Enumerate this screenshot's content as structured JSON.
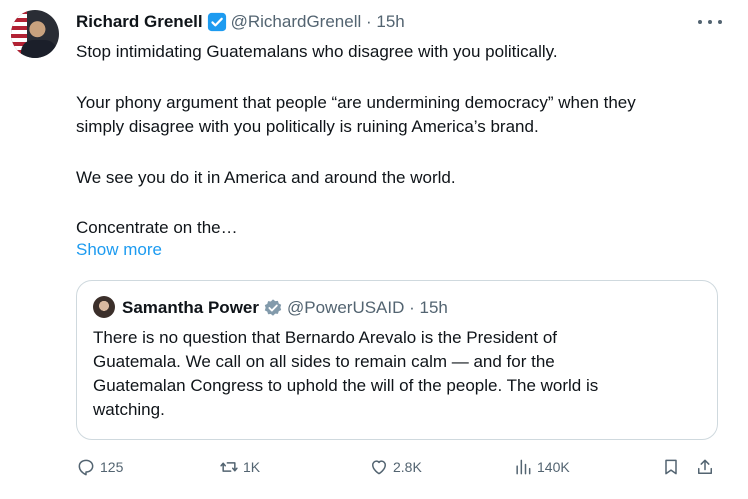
{
  "tweet": {
    "author_name": "Richard Grenell",
    "author_handle": "@RichardGrenell",
    "separator": " · ",
    "time": "15h",
    "lines": [
      "Stop intimidating Guatemalans who disagree with you politically.",
      "Your phony argument that people “are undermining democracy” when they",
      "simply disagree with you politically is ruining America’s brand.",
      "We see you do it in America and around the world.",
      "Concentrate on the…"
    ],
    "show_more": "Show more"
  },
  "quote": {
    "author_name": "Samantha Power",
    "author_handle": "@PowerUSAID",
    "separator": " · ",
    "time": "15h",
    "lines": [
      "There is no question that Bernardo Arevalo is the President of",
      "Guatemala. We call on all sides to remain calm — and for the",
      "Guatemalan Congress to uphold the will of the people. The world is",
      "watching."
    ]
  },
  "actions": {
    "replies": "125",
    "reposts": "1K",
    "likes": "2.8K",
    "views": "140K"
  },
  "icons": [
    "more-icon",
    "verified-icon",
    "reply-icon",
    "repost-icon",
    "like-icon",
    "views-icon",
    "bookmark-icon",
    "share-icon"
  ],
  "colors": {
    "accent": "#1d9bf0",
    "text": "#0f1419",
    "secondary": "#536471",
    "border": "#cfd9de"
  }
}
